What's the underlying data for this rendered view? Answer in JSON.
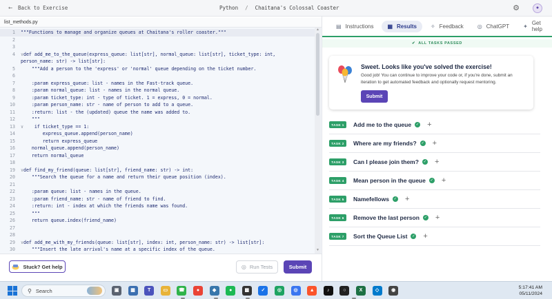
{
  "topbar": {
    "back_label": "Back to Exercise",
    "track": "Python",
    "separator": "/",
    "exercise": "Chaitana's Colossal Coaster",
    "avatar_initial": "•"
  },
  "editor": {
    "file_name": "list_methods.py",
    "lines": [
      {
        "n": "1",
        "fold": "",
        "text": "\"\"\"Functions to manage and organize queues at Chaitana's roller coaster.\"\"\""
      },
      {
        "n": "2",
        "fold": "",
        "text": ""
      },
      {
        "n": "3",
        "fold": "",
        "text": ""
      },
      {
        "n": "4",
        "fold": "∨",
        "text": "def add_me_to_the_queue(express_queue: list[str], normal_queue: list[str], ticket_type: int,"
      },
      {
        "n": "",
        "fold": "",
        "text": "person_name: str) -> list[str]:"
      },
      {
        "n": "5",
        "fold": "",
        "text": "    \"\"\"Add a person to the 'express' or 'normal' queue depending on the ticket number."
      },
      {
        "n": "6",
        "fold": "",
        "text": ""
      },
      {
        "n": "7",
        "fold": "",
        "text": "    :param express_queue: list - names in the Fast-track queue."
      },
      {
        "n": "8",
        "fold": "",
        "text": "    :param normal_queue: list - names in the normal queue."
      },
      {
        "n": "9",
        "fold": "",
        "text": "    :param ticket_type: int - type of ticket. 1 = express, 0 = normal."
      },
      {
        "n": "10",
        "fold": "",
        "text": "    :param person_name: str - name of person to add to a queue."
      },
      {
        "n": "11",
        "fold": "",
        "text": "    :return: list - the (updated) queue the name was added to."
      },
      {
        "n": "12",
        "fold": "",
        "text": "    \"\"\""
      },
      {
        "n": "13",
        "fold": "∨",
        "text": "    if ticket_type == 1:"
      },
      {
        "n": "14",
        "fold": "",
        "text": "        express_queue.append(person_name)"
      },
      {
        "n": "15",
        "fold": "",
        "text": "        return express_queue"
      },
      {
        "n": "16",
        "fold": "",
        "text": "    normal_queue.append(person_name)"
      },
      {
        "n": "17",
        "fold": "",
        "text": "    return normal_queue"
      },
      {
        "n": "18",
        "fold": "",
        "text": ""
      },
      {
        "n": "19",
        "fold": "∨",
        "text": "def find_my_friend(queue: list[str], friend_name: str) -> int:"
      },
      {
        "n": "20",
        "fold": "",
        "text": "    \"\"\"Search the queue for a name and return their queue position (index)."
      },
      {
        "n": "21",
        "fold": "",
        "text": ""
      },
      {
        "n": "22",
        "fold": "",
        "text": "    :param queue: list - names in the queue."
      },
      {
        "n": "23",
        "fold": "",
        "text": "    :param friend_name: str - name of friend to find."
      },
      {
        "n": "24",
        "fold": "",
        "text": "    :return: int - index at which the friends name was found."
      },
      {
        "n": "25",
        "fold": "",
        "text": "    \"\"\""
      },
      {
        "n": "26",
        "fold": "",
        "text": "    return queue.index(friend_name)"
      },
      {
        "n": "27",
        "fold": "",
        "text": ""
      },
      {
        "n": "28",
        "fold": "",
        "text": ""
      },
      {
        "n": "29",
        "fold": "∨",
        "text": "def add_me_with_my_friends(queue: list[str], index: int, person_name: str) -> list[str]:"
      },
      {
        "n": "30",
        "fold": "",
        "text": "    \"\"\"Insert the late arrival's name at a specific index of the queue."
      }
    ],
    "help_label": "Stuck? Get help",
    "run_label": "Run Tests",
    "submit_label": "Submit"
  },
  "panel": {
    "tabs": [
      {
        "label": "Instructions",
        "icon": "▤"
      },
      {
        "label": "Results",
        "icon": "▦"
      },
      {
        "label": "Feedback",
        "icon": "✧"
      },
      {
        "label": "ChatGPT",
        "icon": "◎"
      },
      {
        "label": "Get help",
        "icon": "✦"
      }
    ],
    "passed_text": "ALL TASKS PASSED",
    "card": {
      "title": "Sweet. Looks like you've solved the exercise!",
      "text": "Good job! You can continue to improve your code or, if you're done, submit an iteration to get automated feedback and optionally request mentoring.",
      "button": "Submit"
    },
    "tasks": [
      {
        "badge": "TASK 1",
        "title": "Add me to the queue"
      },
      {
        "badge": "TASK 2",
        "title": "Where are my friends?"
      },
      {
        "badge": "TASK 3",
        "title": "Can I please join them?"
      },
      {
        "badge": "TASK 4",
        "title": "Mean person in the queue"
      },
      {
        "badge": "TASK 5",
        "title": "Namefellows"
      },
      {
        "badge": "TASK 6",
        "title": "Remove the last person"
      },
      {
        "badge": "TASK 7",
        "title": "Sort the Queue List"
      }
    ],
    "colors": {
      "accent": "#5b45b6",
      "success": "#2d9f68"
    }
  },
  "taskbar": {
    "search_label": "Search",
    "apps": [
      "file-explorer-icon",
      "widgets-icon",
      "teams-icon",
      "folder-icon",
      "whatsapp-icon",
      "chrome-icon",
      "python-icon",
      "spotify-icon",
      "qr-icon",
      "todo-icon",
      "chrome-green-icon",
      "signal-icon",
      "brave-icon",
      "tiktok-icon",
      "github-icon",
      "excel-icon",
      "vscode-icon",
      "obs-icon"
    ],
    "time": "5:17:41 AM",
    "date": "05/11/2024"
  }
}
